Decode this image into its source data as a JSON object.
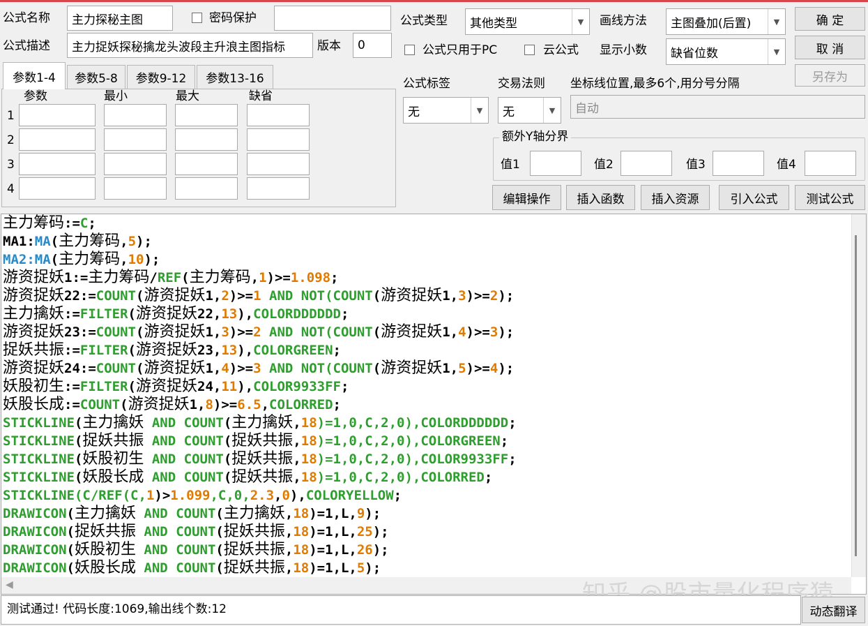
{
  "form": {
    "name_label": "公式名称",
    "name_value": "主力探秘主图",
    "password_label": "密码保护",
    "password_value": "",
    "desc_label": "公式描述",
    "desc_value": "主力捉妖探秘擒龙头波段主升浪主图指标",
    "version_label": "版本",
    "version_value": "0",
    "type_label": "公式类型",
    "type_value": "其他类型",
    "draw_label": "画线方法",
    "draw_value": "主图叠加(后置)",
    "pc_only_label": "公式只用于PC",
    "cloud_label": "云公式",
    "decimal_label": "显示小数",
    "decimal_value": "缺省位数",
    "tag_label": "公式标签",
    "tag_value": "无",
    "rule_label": "交易法则",
    "rule_value": "无",
    "coord_label": "坐标线位置,最多6个,用分号分隔",
    "coord_value": "自动",
    "yaxis_title": "额外Y轴分界",
    "yaxis_values": [
      "值1",
      "值2",
      "值3",
      "值4"
    ]
  },
  "buttons": {
    "ok": "确  定",
    "cancel": "取  消",
    "save_as": "另存为",
    "edit_ops": "编辑操作",
    "insert_func": "插入函数",
    "insert_res": "插入资源",
    "import_formula": "引入公式",
    "test_formula": "测试公式",
    "dyn_translate": "动态翻译"
  },
  "params": {
    "tabs": [
      "参数1-4",
      "参数5-8",
      "参数9-12",
      "参数13-16"
    ],
    "headers": [
      "参数",
      "最小",
      "最大",
      "缺省"
    ],
    "rows": [
      "1",
      "2",
      "3",
      "4"
    ]
  },
  "colors": {
    "keyword": "#2e9e2e",
    "number": "#e07b00",
    "text": "#000000",
    "var_blue": "#2a8ac9"
  },
  "code_lines": [
    [
      [
        "主力筹码",
        "t-cjk",
        "#000000"
      ],
      [
        ":=",
        "",
        "#000000"
      ],
      [
        "C",
        "",
        "#2e9e2e"
      ],
      [
        ";",
        "",
        "#000000"
      ]
    ],
    [
      [
        "MA1:",
        "",
        "#000000"
      ],
      [
        "MA",
        "",
        "#2a8ac9"
      ],
      [
        "(",
        "",
        "#000000"
      ],
      [
        "主力筹码",
        "t-cjk",
        "#000000"
      ],
      [
        ",",
        "",
        "#000000"
      ],
      [
        "5",
        "",
        "#e07b00"
      ],
      [
        ");",
        "",
        "#000000"
      ]
    ],
    [
      [
        "MA2:",
        "",
        "#2a8ac9"
      ],
      [
        "MA",
        "",
        "#2a8ac9"
      ],
      [
        "(",
        "",
        "#000000"
      ],
      [
        "主力筹码",
        "t-cjk",
        "#000000"
      ],
      [
        ",",
        "",
        "#000000"
      ],
      [
        "10",
        "",
        "#e07b00"
      ],
      [
        ");",
        "",
        "#000000"
      ]
    ],
    [
      [
        "游资捉妖",
        "t-cjk",
        "#000000"
      ],
      [
        "1:=",
        "",
        "#000000"
      ],
      [
        "主力筹码",
        "t-cjk",
        "#000000"
      ],
      [
        "/",
        "",
        "#000000"
      ],
      [
        "REF",
        "",
        "#2e9e2e"
      ],
      [
        "(",
        "",
        "#000000"
      ],
      [
        "主力筹码",
        "t-cjk",
        "#000000"
      ],
      [
        ",",
        "",
        "#000000"
      ],
      [
        "1",
        "",
        "#e07b00"
      ],
      [
        ")>=",
        "",
        "#000000"
      ],
      [
        "1.098",
        "",
        "#e07b00"
      ],
      [
        ";",
        "",
        "#000000"
      ]
    ],
    [
      [
        "游资捉妖",
        "t-cjk",
        "#000000"
      ],
      [
        "22:=",
        "",
        "#000000"
      ],
      [
        "COUNT",
        "",
        "#2e9e2e"
      ],
      [
        "(",
        "",
        "#000000"
      ],
      [
        "游资捉妖",
        "t-cjk",
        "#000000"
      ],
      [
        "1,",
        "",
        "#000000"
      ],
      [
        "2",
        "",
        "#e07b00"
      ],
      [
        ")>=",
        "",
        "#000000"
      ],
      [
        "1",
        "",
        "#e07b00"
      ],
      [
        " AND NOT(",
        "",
        "#2e9e2e"
      ],
      [
        "COUNT",
        "",
        "#2e9e2e"
      ],
      [
        "(",
        "",
        "#000000"
      ],
      [
        "游资捉妖",
        "t-cjk",
        "#000000"
      ],
      [
        "1,",
        "",
        "#000000"
      ],
      [
        "3",
        "",
        "#e07b00"
      ],
      [
        ")>=",
        "",
        "#000000"
      ],
      [
        "2",
        "",
        "#e07b00"
      ],
      [
        ");",
        "",
        "#000000"
      ]
    ],
    [
      [
        "主力擒妖",
        "t-cjk",
        "#000000"
      ],
      [
        ":=",
        "",
        "#000000"
      ],
      [
        "FILTER",
        "",
        "#2e9e2e"
      ],
      [
        "(",
        "",
        "#000000"
      ],
      [
        "游资捉妖",
        "t-cjk",
        "#000000"
      ],
      [
        "22,",
        "",
        "#000000"
      ],
      [
        "13",
        "",
        "#e07b00"
      ],
      [
        "),",
        "",
        "#000000"
      ],
      [
        "COLORDDDDDD",
        "",
        "#2e9e2e"
      ],
      [
        ";",
        "",
        "#000000"
      ]
    ],
    [
      [
        "游资捉妖",
        "t-cjk",
        "#000000"
      ],
      [
        "23:=",
        "",
        "#000000"
      ],
      [
        "COUNT",
        "",
        "#2e9e2e"
      ],
      [
        "(",
        "",
        "#000000"
      ],
      [
        "游资捉妖",
        "t-cjk",
        "#000000"
      ],
      [
        "1,",
        "",
        "#000000"
      ],
      [
        "3",
        "",
        "#e07b00"
      ],
      [
        ")>=",
        "",
        "#000000"
      ],
      [
        "2",
        "",
        "#e07b00"
      ],
      [
        " AND NOT(",
        "",
        "#2e9e2e"
      ],
      [
        "COUNT",
        "",
        "#2e9e2e"
      ],
      [
        "(",
        "",
        "#000000"
      ],
      [
        "游资捉妖",
        "t-cjk",
        "#000000"
      ],
      [
        "1,",
        "",
        "#000000"
      ],
      [
        "4",
        "",
        "#e07b00"
      ],
      [
        ")>=",
        "",
        "#000000"
      ],
      [
        "3",
        "",
        "#e07b00"
      ],
      [
        ");",
        "",
        "#000000"
      ]
    ],
    [
      [
        "捉妖共振",
        "t-cjk",
        "#000000"
      ],
      [
        ":=",
        "",
        "#000000"
      ],
      [
        "FILTER",
        "",
        "#2e9e2e"
      ],
      [
        "(",
        "",
        "#000000"
      ],
      [
        "游资捉妖",
        "t-cjk",
        "#000000"
      ],
      [
        "23,",
        "",
        "#000000"
      ],
      [
        "13",
        "",
        "#e07b00"
      ],
      [
        "),",
        "",
        "#000000"
      ],
      [
        "COLORGREEN",
        "",
        "#2e9e2e"
      ],
      [
        ";",
        "",
        "#000000"
      ]
    ],
    [
      [
        "游资捉妖",
        "t-cjk",
        "#000000"
      ],
      [
        "24:=",
        "",
        "#000000"
      ],
      [
        "COUNT",
        "",
        "#2e9e2e"
      ],
      [
        "(",
        "",
        "#000000"
      ],
      [
        "游资捉妖",
        "t-cjk",
        "#000000"
      ],
      [
        "1,",
        "",
        "#000000"
      ],
      [
        "4",
        "",
        "#e07b00"
      ],
      [
        ")>=",
        "",
        "#000000"
      ],
      [
        "3",
        "",
        "#e07b00"
      ],
      [
        " AND NOT(",
        "",
        "#2e9e2e"
      ],
      [
        "COUNT",
        "",
        "#2e9e2e"
      ],
      [
        "(",
        "",
        "#000000"
      ],
      [
        "游资捉妖",
        "t-cjk",
        "#000000"
      ],
      [
        "1,",
        "",
        "#000000"
      ],
      [
        "5",
        "",
        "#e07b00"
      ],
      [
        ")>=",
        "",
        "#000000"
      ],
      [
        "4",
        "",
        "#e07b00"
      ],
      [
        ");",
        "",
        "#000000"
      ]
    ],
    [
      [
        "妖股初生",
        "t-cjk",
        "#000000"
      ],
      [
        ":=",
        "",
        "#000000"
      ],
      [
        "FILTER",
        "",
        "#2e9e2e"
      ],
      [
        "(",
        "",
        "#000000"
      ],
      [
        "游资捉妖",
        "t-cjk",
        "#000000"
      ],
      [
        "24,",
        "",
        "#000000"
      ],
      [
        "11",
        "",
        "#e07b00"
      ],
      [
        "),",
        "",
        "#000000"
      ],
      [
        "COLOR9933FF",
        "",
        "#2e9e2e"
      ],
      [
        ";",
        "",
        "#000000"
      ]
    ],
    [
      [
        "妖股长成",
        "t-cjk",
        "#000000"
      ],
      [
        ":=",
        "",
        "#000000"
      ],
      [
        "COUNT",
        "",
        "#2e9e2e"
      ],
      [
        "(",
        "",
        "#000000"
      ],
      [
        "游资捉妖",
        "t-cjk",
        "#000000"
      ],
      [
        "1,",
        "",
        "#000000"
      ],
      [
        "8",
        "",
        "#e07b00"
      ],
      [
        ")>=",
        "",
        "#000000"
      ],
      [
        "6.5",
        "",
        "#e07b00"
      ],
      [
        ",",
        "",
        "#000000"
      ],
      [
        "COLORRED",
        "",
        "#2e9e2e"
      ],
      [
        ";",
        "",
        "#000000"
      ]
    ],
    [
      [
        "STICKLINE",
        "",
        "#2e9e2e"
      ],
      [
        "(",
        "",
        "#000000"
      ],
      [
        "主力擒妖",
        "t-cjk",
        "#000000"
      ],
      [
        " AND ",
        "",
        "#2e9e2e"
      ],
      [
        "COUNT",
        "",
        "#2e9e2e"
      ],
      [
        "(",
        "",
        "#000000"
      ],
      [
        "主力擒妖",
        "t-cjk",
        "#000000"
      ],
      [
        ",",
        "",
        "#000000"
      ],
      [
        "18",
        "",
        "#e07b00"
      ],
      [
        ")=1,0,C,2,0),",
        "",
        "#2e9e2e"
      ],
      [
        "COLORDDDDDD",
        "",
        "#2e9e2e"
      ],
      [
        ";",
        "",
        "#000000"
      ]
    ],
    [
      [
        "STICKLINE",
        "",
        "#2e9e2e"
      ],
      [
        "(",
        "",
        "#000000"
      ],
      [
        "捉妖共振",
        "t-cjk",
        "#000000"
      ],
      [
        " AND ",
        "",
        "#2e9e2e"
      ],
      [
        "COUNT",
        "",
        "#2e9e2e"
      ],
      [
        "(",
        "",
        "#000000"
      ],
      [
        "捉妖共振",
        "t-cjk",
        "#000000"
      ],
      [
        ",",
        "",
        "#000000"
      ],
      [
        "18",
        "",
        "#e07b00"
      ],
      [
        ")=1,0,C,2,0),",
        "",
        "#2e9e2e"
      ],
      [
        "COLORGREEN",
        "",
        "#2e9e2e"
      ],
      [
        ";",
        "",
        "#000000"
      ]
    ],
    [
      [
        "STICKLINE",
        "",
        "#2e9e2e"
      ],
      [
        "(",
        "",
        "#000000"
      ],
      [
        "妖股初生",
        "t-cjk",
        "#000000"
      ],
      [
        " AND ",
        "",
        "#2e9e2e"
      ],
      [
        "COUNT",
        "",
        "#2e9e2e"
      ],
      [
        "(",
        "",
        "#000000"
      ],
      [
        "捉妖共振",
        "t-cjk",
        "#000000"
      ],
      [
        ",",
        "",
        "#000000"
      ],
      [
        "18",
        "",
        "#e07b00"
      ],
      [
        ")=1,0,C,2,0),",
        "",
        "#2e9e2e"
      ],
      [
        "COLOR9933FF",
        "",
        "#2e9e2e"
      ],
      [
        ";",
        "",
        "#000000"
      ]
    ],
    [
      [
        "STICKLINE",
        "",
        "#2e9e2e"
      ],
      [
        "(",
        "",
        "#000000"
      ],
      [
        "妖股长成",
        "t-cjk",
        "#000000"
      ],
      [
        " AND ",
        "",
        "#2e9e2e"
      ],
      [
        "COUNT",
        "",
        "#2e9e2e"
      ],
      [
        "(",
        "",
        "#000000"
      ],
      [
        "捉妖共振",
        "t-cjk",
        "#000000"
      ],
      [
        ",",
        "",
        "#000000"
      ],
      [
        "18",
        "",
        "#e07b00"
      ],
      [
        ")=1,0,C,2,0),",
        "",
        "#2e9e2e"
      ],
      [
        "COLORRED",
        "",
        "#2e9e2e"
      ],
      [
        ";",
        "",
        "#000000"
      ]
    ],
    [
      [
        "STICKLINE",
        "",
        "#2e9e2e"
      ],
      [
        "(C/",
        "",
        "#2e9e2e"
      ],
      [
        "REF",
        "",
        "#2e9e2e"
      ],
      [
        "(C,",
        "",
        "#2e9e2e"
      ],
      [
        "1",
        "",
        "#e07b00"
      ],
      [
        ")>",
        "",
        "#000000"
      ],
      [
        "1.099",
        "",
        "#e07b00"
      ],
      [
        ",C,0,",
        "",
        "#2e9e2e"
      ],
      [
        "2.3",
        "",
        "#e07b00"
      ],
      [
        ",",
        "",
        "#000000"
      ],
      [
        "0",
        "",
        "#e07b00"
      ],
      [
        "),",
        "",
        "#000000"
      ],
      [
        "COLORYELLOW",
        "",
        "#2e9e2e"
      ],
      [
        ";",
        "",
        "#000000"
      ]
    ],
    [
      [
        "DRAWICON",
        "",
        "#2e9e2e"
      ],
      [
        "(",
        "",
        "#000000"
      ],
      [
        "主力擒妖",
        "t-cjk",
        "#000000"
      ],
      [
        " AND ",
        "",
        "#2e9e2e"
      ],
      [
        "COUNT",
        "",
        "#2e9e2e"
      ],
      [
        "(",
        "",
        "#000000"
      ],
      [
        "主力擒妖",
        "t-cjk",
        "#000000"
      ],
      [
        ",",
        "",
        "#000000"
      ],
      [
        "18",
        "",
        "#e07b00"
      ],
      [
        ")=1,L,",
        "",
        "#000000"
      ],
      [
        "9",
        "",
        "#e07b00"
      ],
      [
        ");",
        "",
        "#000000"
      ]
    ],
    [
      [
        "DRAWICON",
        "",
        "#2e9e2e"
      ],
      [
        "(",
        "",
        "#000000"
      ],
      [
        "捉妖共振",
        "t-cjk",
        "#000000"
      ],
      [
        " AND ",
        "",
        "#2e9e2e"
      ],
      [
        "COUNT",
        "",
        "#2e9e2e"
      ],
      [
        "(",
        "",
        "#000000"
      ],
      [
        "捉妖共振",
        "t-cjk",
        "#000000"
      ],
      [
        ",",
        "",
        "#000000"
      ],
      [
        "18",
        "",
        "#e07b00"
      ],
      [
        ")=1,L,",
        "",
        "#000000"
      ],
      [
        "25",
        "",
        "#e07b00"
      ],
      [
        ");",
        "",
        "#000000"
      ]
    ],
    [
      [
        "DRAWICON",
        "",
        "#2e9e2e"
      ],
      [
        "(",
        "",
        "#000000"
      ],
      [
        "妖股初生",
        "t-cjk",
        "#000000"
      ],
      [
        " AND ",
        "",
        "#2e9e2e"
      ],
      [
        "COUNT",
        "",
        "#2e9e2e"
      ],
      [
        "(",
        "",
        "#000000"
      ],
      [
        "捉妖共振",
        "t-cjk",
        "#000000"
      ],
      [
        ",",
        "",
        "#000000"
      ],
      [
        "18",
        "",
        "#e07b00"
      ],
      [
        ")=1,L,",
        "",
        "#000000"
      ],
      [
        "26",
        "",
        "#e07b00"
      ],
      [
        ");",
        "",
        "#000000"
      ]
    ],
    [
      [
        "DRAWICON",
        "",
        "#2e9e2e"
      ],
      [
        "(",
        "",
        "#000000"
      ],
      [
        "妖股长成",
        "t-cjk",
        "#000000"
      ],
      [
        " AND ",
        "",
        "#2e9e2e"
      ],
      [
        "COUNT",
        "",
        "#2e9e2e"
      ],
      [
        "(",
        "",
        "#000000"
      ],
      [
        "捉妖共振",
        "t-cjk",
        "#000000"
      ],
      [
        ",",
        "",
        "#000000"
      ],
      [
        "18",
        "",
        "#e07b00"
      ],
      [
        ")=1,L,",
        "",
        "#000000"
      ],
      [
        "5",
        "",
        "#e07b00"
      ],
      [
        ");",
        "",
        "#000000"
      ]
    ]
  ],
  "status_text": "测试通过! 代码长度:1069,输出线个数:12",
  "watermark": "知乎 @股市量化程序猿",
  "icons": {
    "dropdown": "chevron-down-icon",
    "scroll_left": "arrow-left-icon"
  }
}
